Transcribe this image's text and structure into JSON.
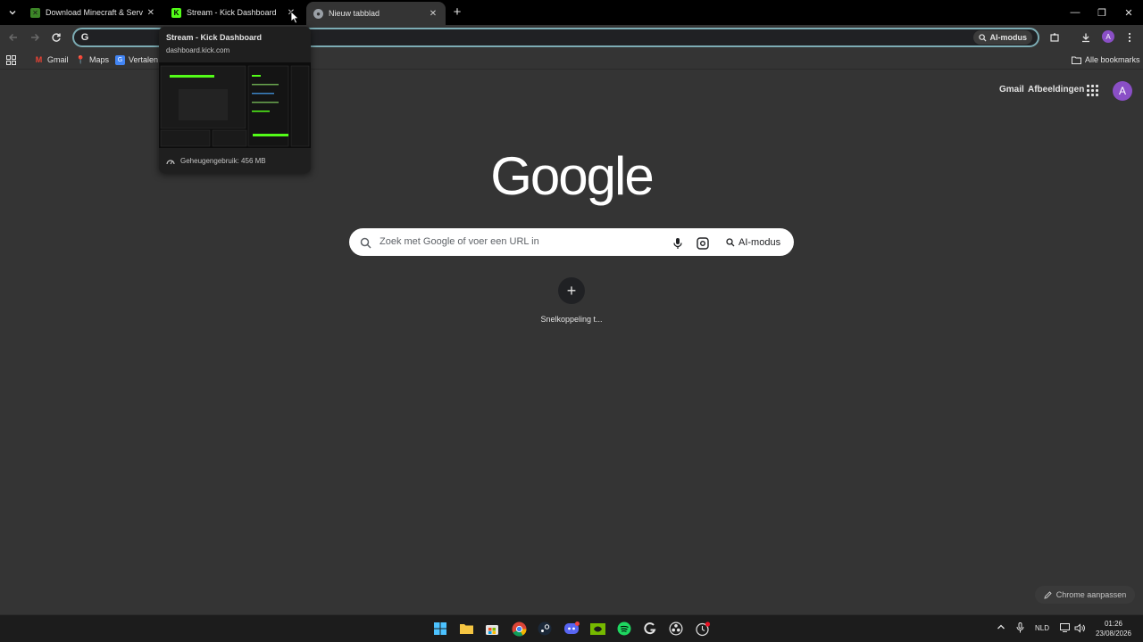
{
  "browser": {
    "tabs": [
      {
        "title": "Download Minecraft & Server S",
        "favicon": "minecraft-icon",
        "favicon_color": "#3c8527",
        "active": false
      },
      {
        "title": "Stream - Kick Dashboard",
        "favicon": "kick-icon",
        "favicon_color": "#53fc18",
        "active": false
      },
      {
        "title": "Nieuw tabblad",
        "favicon": "chrome-icon",
        "favicon_color": "#9aa0a6",
        "active": true
      }
    ],
    "omnibox": {
      "value": "",
      "ai_chip_label": "AI-modus"
    },
    "accent_color": "#7cacb4",
    "profile_initial": "A",
    "profile_color": "#8a4fc6"
  },
  "bookmarks": {
    "items": [
      {
        "label": "Gmail",
        "icon": "gmail-icon"
      },
      {
        "label": "Maps",
        "icon": "maps-icon"
      },
      {
        "label": "Vertalen",
        "icon": "translate-icon"
      }
    ],
    "all_bookmarks_label": "Alle bookmarks"
  },
  "hover_card": {
    "title": "Stream - Kick Dashboard",
    "url": "dashboard.kick.com",
    "memory": "Geheugengebruik: 456 MB"
  },
  "page": {
    "top_links": {
      "gmail": "Gmail",
      "images": "Afbeeldingen"
    },
    "logo": "Google",
    "search": {
      "placeholder": "Zoek met Google of voer een URL in",
      "ai_label": "AI-modus"
    },
    "shortcut_label": "Snelkoppeling t...",
    "customize_label": "Chrome aanpassen"
  },
  "taskbar": {
    "apps": [
      "windows-start-icon",
      "file-explorer-icon",
      "microsoft-store-icon",
      "chrome-icon",
      "steam-icon",
      "discord-icon",
      "nvidia-icon",
      "spotify-icon",
      "g-hub-icon",
      "obs-icon",
      "recorder-icon"
    ],
    "language": "NLD",
    "time": "01:26",
    "date": "23/08/2026"
  }
}
